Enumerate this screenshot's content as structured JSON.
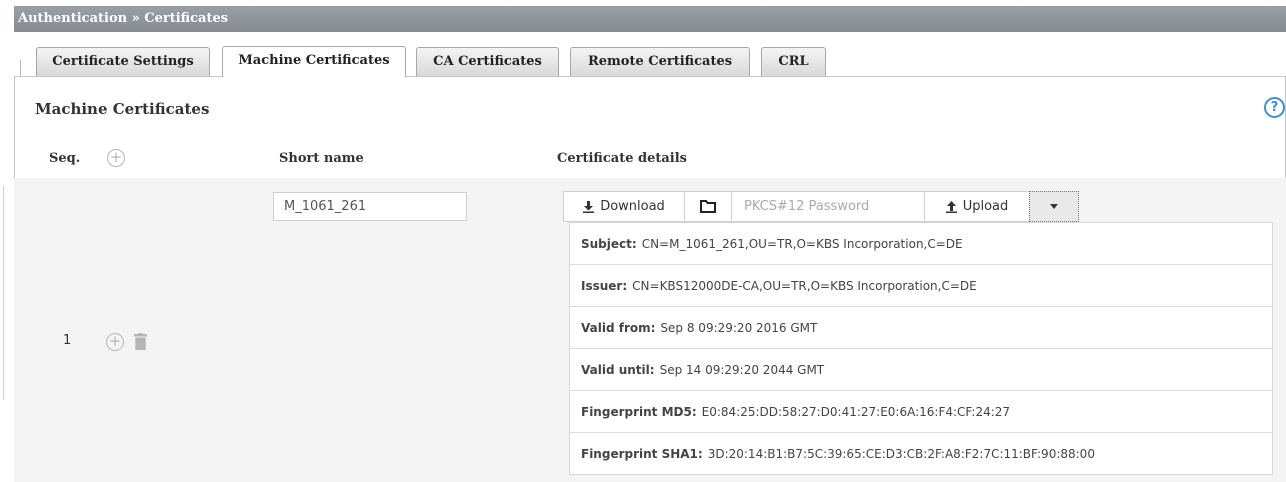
{
  "breadcrumb": "Authentication » Certificates",
  "tabs": [
    {
      "label": "Certificate Settings"
    },
    {
      "label": "Machine Certificates"
    },
    {
      "label": "CA Certificates"
    },
    {
      "label": "Remote Certificates"
    },
    {
      "label": "CRL"
    }
  ],
  "active_tab": "Machine Certificates",
  "panel": {
    "title": "Machine Certificates",
    "help_icon": "?"
  },
  "columns": {
    "seq": "Seq.",
    "short_name": "Short name",
    "details": "Certificate details"
  },
  "row": {
    "seq": "1",
    "short_name_value": "M_1061_261",
    "download_label": "Download",
    "password_placeholder": "PKCS#12 Password",
    "upload_label": "Upload",
    "details": [
      {
        "label": "Subject:",
        "value": "CN=M_1061_261,OU=TR,O=KBS Incorporation,C=DE"
      },
      {
        "label": "Issuer:",
        "value": "CN=KBS12000DE-CA,OU=TR,O=KBS Incorporation,C=DE"
      },
      {
        "label": "Valid from:",
        "value": "Sep 8 09:29:20 2016 GMT"
      },
      {
        "label": "Valid until:",
        "value": "Sep 14 09:29:20 2044 GMT"
      },
      {
        "label": "Fingerprint MD5:",
        "value": "E0:84:25:DD:58:27:D0:41:27:E0:6A:16:F4:CF:24:27"
      },
      {
        "label": "Fingerprint SHA1:",
        "value": "3D:20:14:B1:B7:5C:39:65:CE:D3:CB:2F:A8:F2:7C:11:BF:90:88:00"
      }
    ]
  },
  "colors": {
    "header_bar": "#8e949a",
    "help_blue": "#3d8fd0",
    "row_background": "#f4f4f4"
  }
}
